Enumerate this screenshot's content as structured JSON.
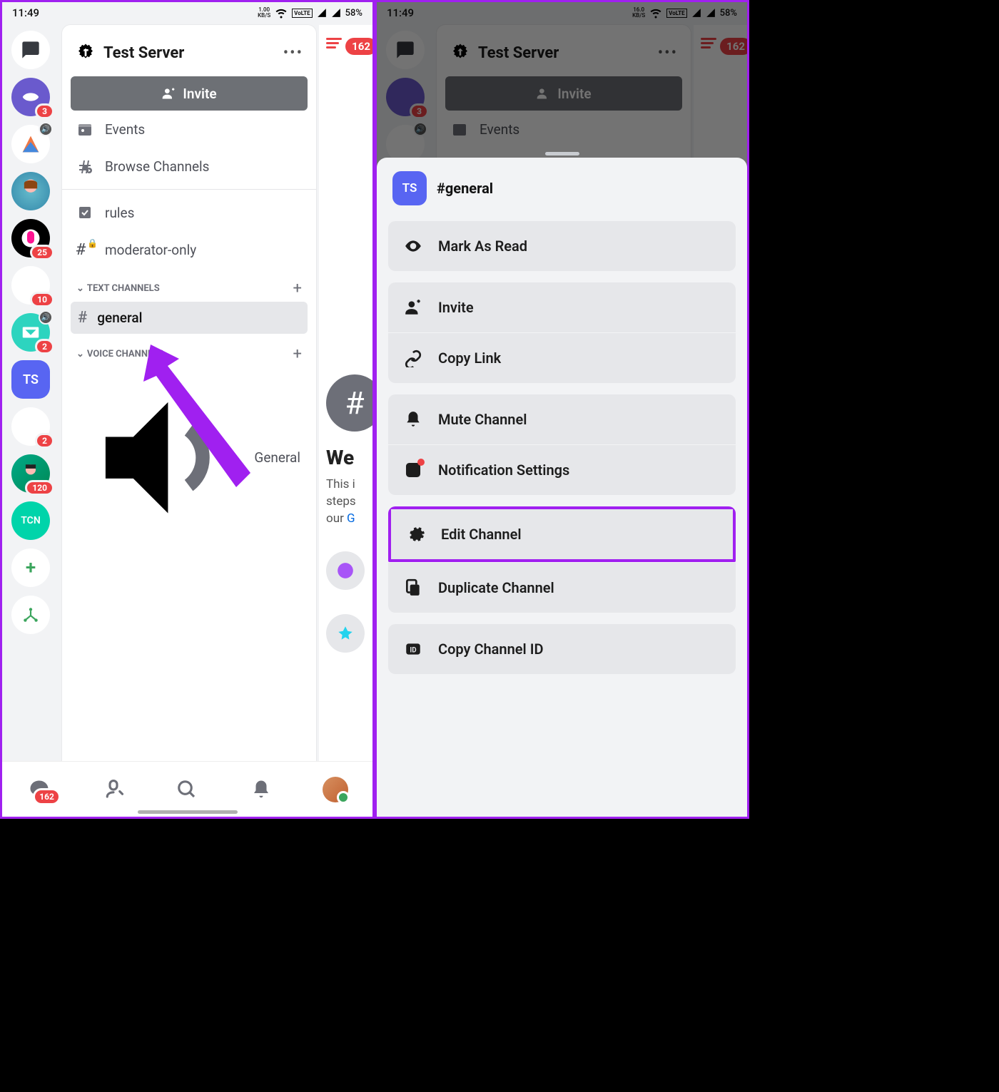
{
  "statusbar": {
    "time": "11:49",
    "speed_val": "1.00",
    "speed_unit": "KB/S",
    "speed_val2": "16.0",
    "battery": "58%"
  },
  "server": {
    "title": "Test Server",
    "invite_label": "Invite",
    "events_label": "Events",
    "browse_label": "Browse Channels",
    "rules_label": "rules",
    "mod_label": "moderator-only",
    "cat_text": "TEXT CHANNELS",
    "cat_voice": "VOICE CHANNELS",
    "general_label": "general",
    "voice_general_label": "General",
    "ts_abbrev": "TS"
  },
  "badges": {
    "s2": "3",
    "s5": "25",
    "s6": "10",
    "s7": "2",
    "s9": "120",
    "bn": "162",
    "peek": "162",
    "gen_unread": "2"
  },
  "peek": {
    "heading": "We",
    "body_1": "This i",
    "body_2": "steps",
    "body_3": "our ",
    "body_link": "G"
  },
  "sheet": {
    "server_abbrev": "TS",
    "title": "#general",
    "items": {
      "mark_read": "Mark As Read",
      "invite": "Invite",
      "copy_link": "Copy Link",
      "mute": "Mute Channel",
      "notif": "Notification Settings",
      "edit": "Edit Channel",
      "duplicate": "Duplicate Channel",
      "copy_id": "Copy Channel ID"
    }
  },
  "tcn_label": "TCN"
}
